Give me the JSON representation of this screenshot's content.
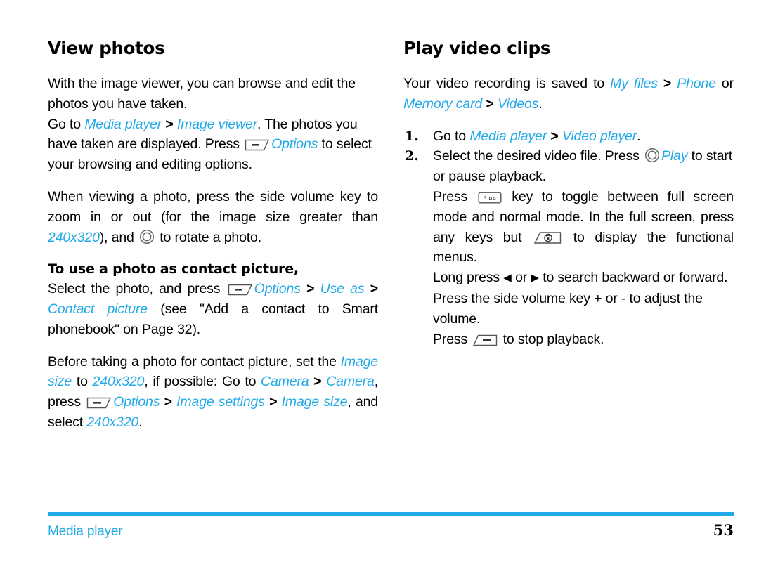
{
  "page": {
    "number": "53",
    "chapter": "Media player",
    "accent_color": "#22A9E8",
    "text_color": "#000000",
    "background": "#ffffff"
  },
  "left_column": {
    "title": "View photos",
    "p1": {
      "t1": "With the image viewer, you can browse and edit the photos you have taken."
    },
    "p2": {
      "t1": "Go to ",
      "link1": "Media player",
      "sep1": ">",
      "link2": "Image viewer",
      "t2": ". The photos you have taken are displayed. Press ",
      "icon1": "left-softkey-icon",
      "link3": "Options",
      "t3": " to select your browsing and editing options."
    },
    "p3": {
      "t1": "When viewing a photo, press the side volume key  to zoom in or out (for the image size greater than ",
      "link1": "240x320",
      "t2": "), and ",
      "icon1": "ok-navigation-key-icon",
      "t3": " to rotate a photo."
    },
    "subtitle": "To use a photo as contact picture,",
    "p4": {
      "t1": "Select the photo, and press ",
      "icon1": "left-softkey-icon",
      "link1": "Options",
      "sep1": ">",
      "link2": "Use as",
      "sep2": ">",
      "link3": "Contact picture",
      "t2": " (see \"Add a contact to Smart phonebook\" on Page 32)."
    },
    "p5": {
      "t1": "Before taking a photo for contact picture, set the ",
      "link1": "Image size",
      "t2": " to ",
      "link2": "240x320",
      "t3": ", if possible: Go to ",
      "link3": "Camera",
      "sep1": ">",
      "link4": "Camera",
      "t4": ", press ",
      "icon1": "left-softkey-icon",
      "link5": "Options",
      "sep2": ">",
      "link6": "Image settings",
      "sep3": ">",
      "link7": "Image size",
      "t5": ", and select ",
      "link8": "240x320",
      "t6": "."
    }
  },
  "right_column": {
    "title": "Play video clips",
    "p1": {
      "t1": "Your video recording is saved to ",
      "link1": "My files",
      "sep1": ">",
      "link2": "Phone",
      "t2": " or ",
      "link3": "Memory card",
      "sep2": ">",
      "link4": "Videos",
      "t3": "."
    },
    "steps": [
      {
        "num": "1.",
        "t1": "Go to ",
        "link1": "Media player",
        "sep1": ">",
        "link2": "Video player",
        "t2": "."
      },
      {
        "num": "2.",
        "t1": "Select the desired video file. Press ",
        "icon1": "ok-navigation-key-icon",
        "link1": "Play",
        "t2": " to start or pause playback."
      }
    ],
    "p2": {
      "t1": "Press ",
      "icon1": "star-key-icon",
      "t2": " key to toggle between full screen mode and normal mode. In the full screen, press any keys but ",
      "icon2": "end-call-key-icon",
      "t3": " to display the functional menus."
    },
    "p3": {
      "t1": "Long press ",
      "icon1": "left-triangle-icon",
      "t2": " or ",
      "icon2": "right-triangle-icon",
      "t3": " to search backward or forward."
    },
    "p4": {
      "t1": "Press the side volume key + or - to adjust the volume."
    },
    "p5": {
      "t1": "Press ",
      "icon1": "right-softkey-icon",
      "t2": " to stop playback."
    }
  }
}
